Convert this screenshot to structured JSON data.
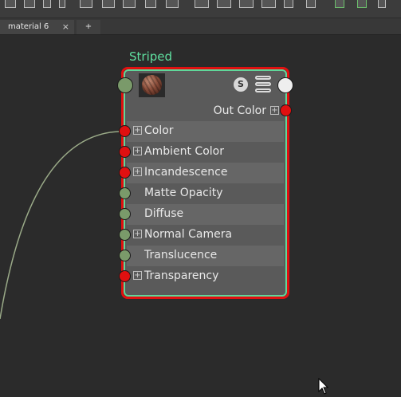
{
  "tabs": [
    {
      "label": "material 6",
      "close_glyph": "×"
    },
    {
      "label": "+"
    }
  ],
  "node": {
    "title": "Striped",
    "swatch_button_label": "S",
    "output": {
      "label": "Out Color",
      "expand_glyph": "+"
    },
    "attributes": [
      {
        "label": "Color",
        "expandable": true,
        "port_color": "red",
        "connected": true
      },
      {
        "label": "Ambient Color",
        "expandable": true,
        "port_color": "red",
        "connected": false
      },
      {
        "label": "Incandescence",
        "expandable": true,
        "port_color": "red",
        "connected": false
      },
      {
        "label": "Matte Opacity",
        "expandable": false,
        "port_color": "green",
        "connected": false
      },
      {
        "label": "Diffuse",
        "expandable": false,
        "port_color": "green",
        "connected": false
      },
      {
        "label": "Normal Camera",
        "expandable": true,
        "port_color": "green",
        "connected": false
      },
      {
        "label": "Translucence",
        "expandable": false,
        "port_color": "green",
        "connected": false
      },
      {
        "label": "Transparency",
        "expandable": true,
        "port_color": "red",
        "connected": false
      }
    ],
    "expand_glyph": "+"
  },
  "colors": {
    "background": "#2b2b2b",
    "selection_border": "#e01010",
    "node_border": "#5fd79a",
    "title": "#5fe0a0",
    "port_red": "#e01010",
    "port_green": "#7a9a6a",
    "connection_line": "#9aaa88"
  },
  "icons": [
    "sphere-thumbnail-icon",
    "swatch-s-icon",
    "stack-icon",
    "mouse-cursor-icon"
  ]
}
